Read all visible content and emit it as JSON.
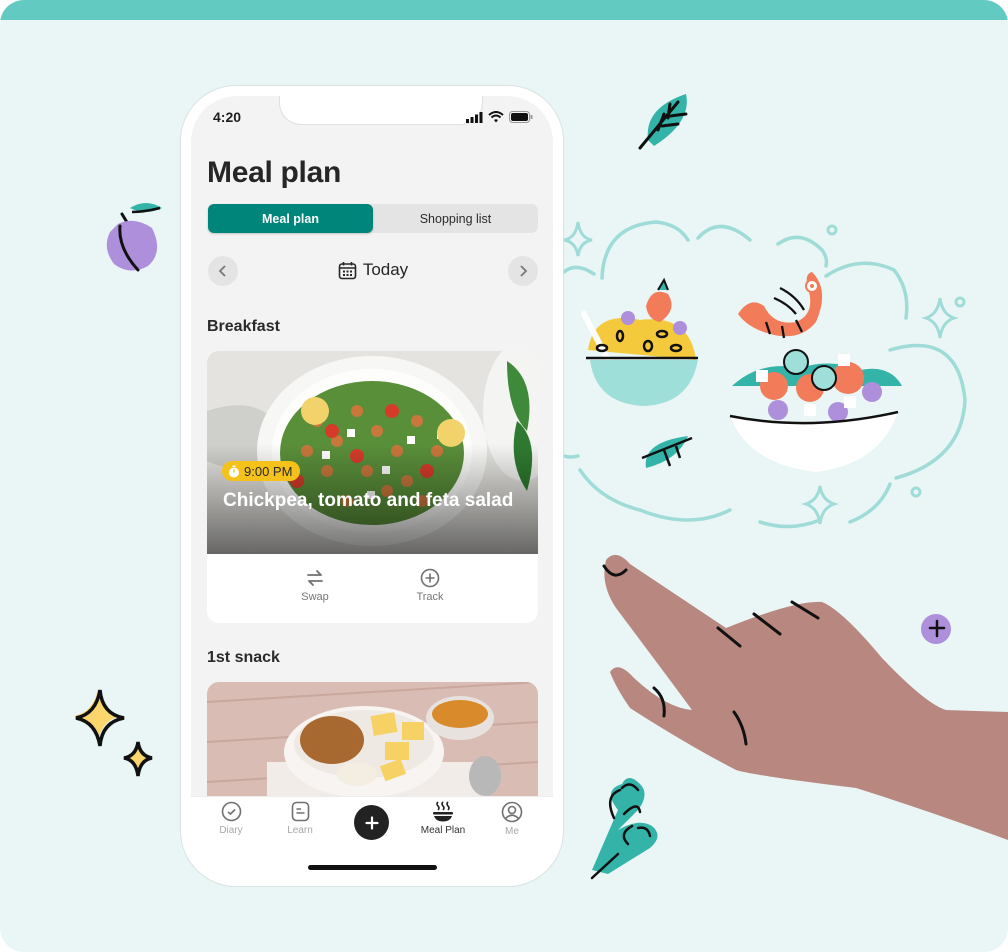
{
  "colors": {
    "background": "#e9f6f5",
    "top_band": "#63cac1",
    "accent": "#00857a",
    "badge": "#f4c21b",
    "hand": "#b88880",
    "plum": "#ad8fdb",
    "leaf": "#34b3a8"
  },
  "status_bar": {
    "time": "4:20",
    "icons": [
      "signal-icon",
      "wifi-icon",
      "battery-icon"
    ]
  },
  "header": {
    "title": "Meal plan"
  },
  "segmented_control": {
    "tabs": [
      {
        "label": "Meal plan",
        "active": true
      },
      {
        "label": "Shopping list",
        "active": false
      }
    ]
  },
  "date_nav": {
    "label": "Today",
    "icon": "calendar-icon",
    "prev_icon": "chevron-left-icon",
    "next_icon": "chevron-right-icon"
  },
  "sections": [
    {
      "title": "Breakfast",
      "meal": {
        "time": "9:00 PM",
        "name": "Chickpea, tomato and feta salad",
        "actions": [
          {
            "label": "Swap",
            "icon": "swap-icon"
          },
          {
            "label": "Track",
            "icon": "plus-circle-icon"
          }
        ]
      }
    },
    {
      "title": "1st snack",
      "meal": {}
    }
  ],
  "tab_bar": {
    "tabs": [
      {
        "label": "Diary",
        "icon": "check-circle-icon",
        "active": false
      },
      {
        "label": "Learn",
        "icon": "document-icon",
        "active": false
      },
      {
        "label": "",
        "icon": "add-icon",
        "active": false
      },
      {
        "label": "Meal Plan",
        "icon": "bowl-icon",
        "active": true
      },
      {
        "label": "Me",
        "icon": "profile-icon",
        "active": false
      }
    ]
  }
}
